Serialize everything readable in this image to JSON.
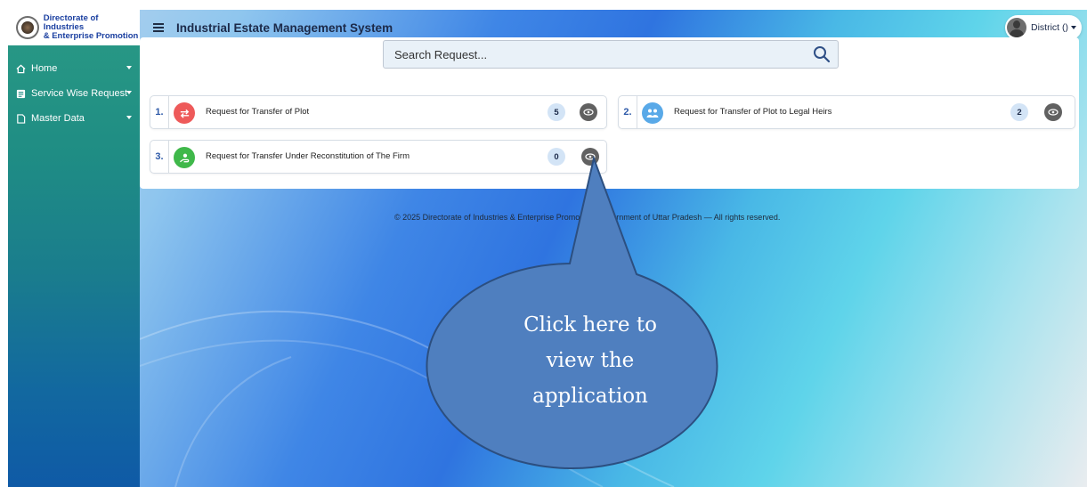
{
  "sidebar": {
    "org_name_line1": "Directorate of Industries",
    "org_name_line2": "& Enterprise Promotion",
    "items": [
      {
        "label": "Home",
        "icon": "home-icon"
      },
      {
        "label": "Service Wise Request",
        "icon": "list-icon"
      },
      {
        "label": "Master Data",
        "icon": "document-icon"
      }
    ]
  },
  "header": {
    "title": "Industrial Estate Management System",
    "user_label": "District ()"
  },
  "search": {
    "placeholder": "Search Request..."
  },
  "requests": [
    {
      "index": "1.",
      "label": "Request for Transfer of Plot",
      "count": "5",
      "icon_color": "#ee5a5a",
      "icon": "transfer-icon"
    },
    {
      "index": "2.",
      "label": "Request for Transfer of Plot to Legal Heirs",
      "count": "2",
      "icon_color": "#59a9e8",
      "icon": "users-icon"
    },
    {
      "index": "3.",
      "label": "Request for Transfer Under Reconstitution of The Firm",
      "count": "0",
      "icon_color": "#3fb84a",
      "icon": "user-hand-icon"
    }
  ],
  "footer": {
    "text": "© 2025 Directorate of Industries & Enterprise Promotion, Government of Uttar Pradesh — All rights reserved."
  },
  "callout": {
    "line1": "Click here to",
    "line2": "view the",
    "line3": "application",
    "color": "#4f7fbf"
  }
}
